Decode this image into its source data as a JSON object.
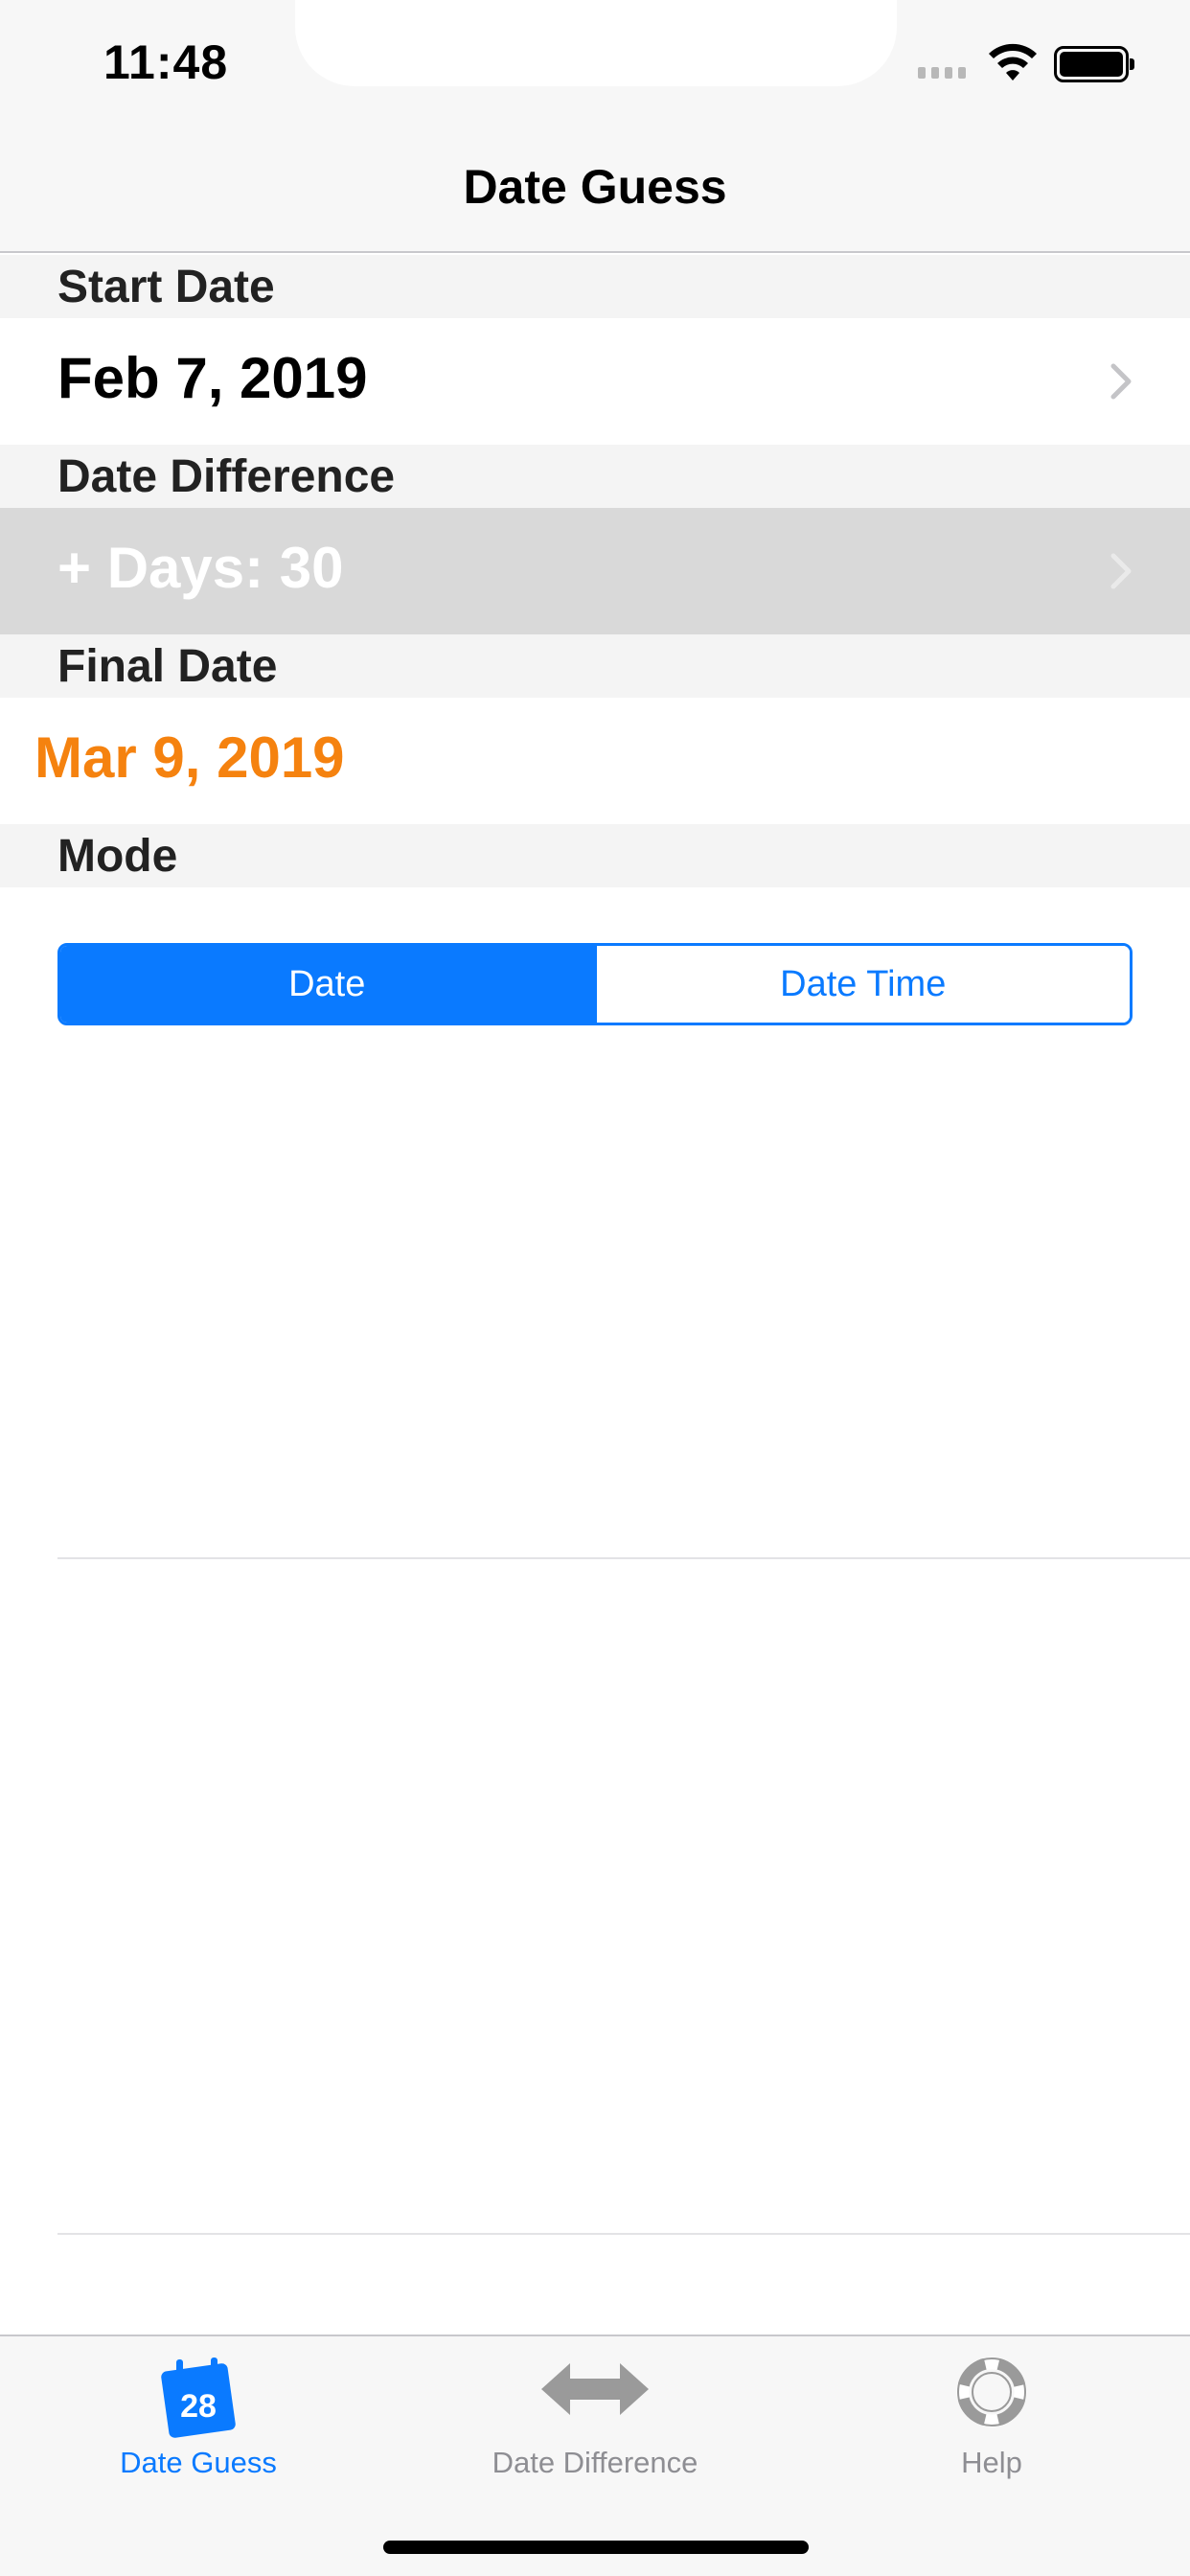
{
  "status_bar": {
    "time": "11:48"
  },
  "nav": {
    "title": "Date Guess"
  },
  "sections": {
    "start_date": {
      "header": "Start Date",
      "value": "Feb 7, 2019"
    },
    "date_difference": {
      "header": "Date Difference",
      "value": "+ Days: 30"
    },
    "final_date": {
      "header": "Final Date",
      "value": "Mar 9, 2019"
    },
    "mode": {
      "header": "Mode",
      "options": [
        "Date",
        "Date Time"
      ],
      "selected": "Date"
    }
  },
  "tabs": [
    {
      "label": "Date Guess",
      "icon": "calendar-icon",
      "icon_text": "28",
      "active": true
    },
    {
      "label": "Date Difference",
      "icon": "double-arrow-icon",
      "active": false
    },
    {
      "label": "Help",
      "icon": "lifebuoy-icon",
      "active": false
    }
  ],
  "colors": {
    "accent": "#0a7aff",
    "final_date": "#f5820f",
    "disabled_row": "#d9d9d9",
    "inactive_tab": "#8e8e93"
  }
}
